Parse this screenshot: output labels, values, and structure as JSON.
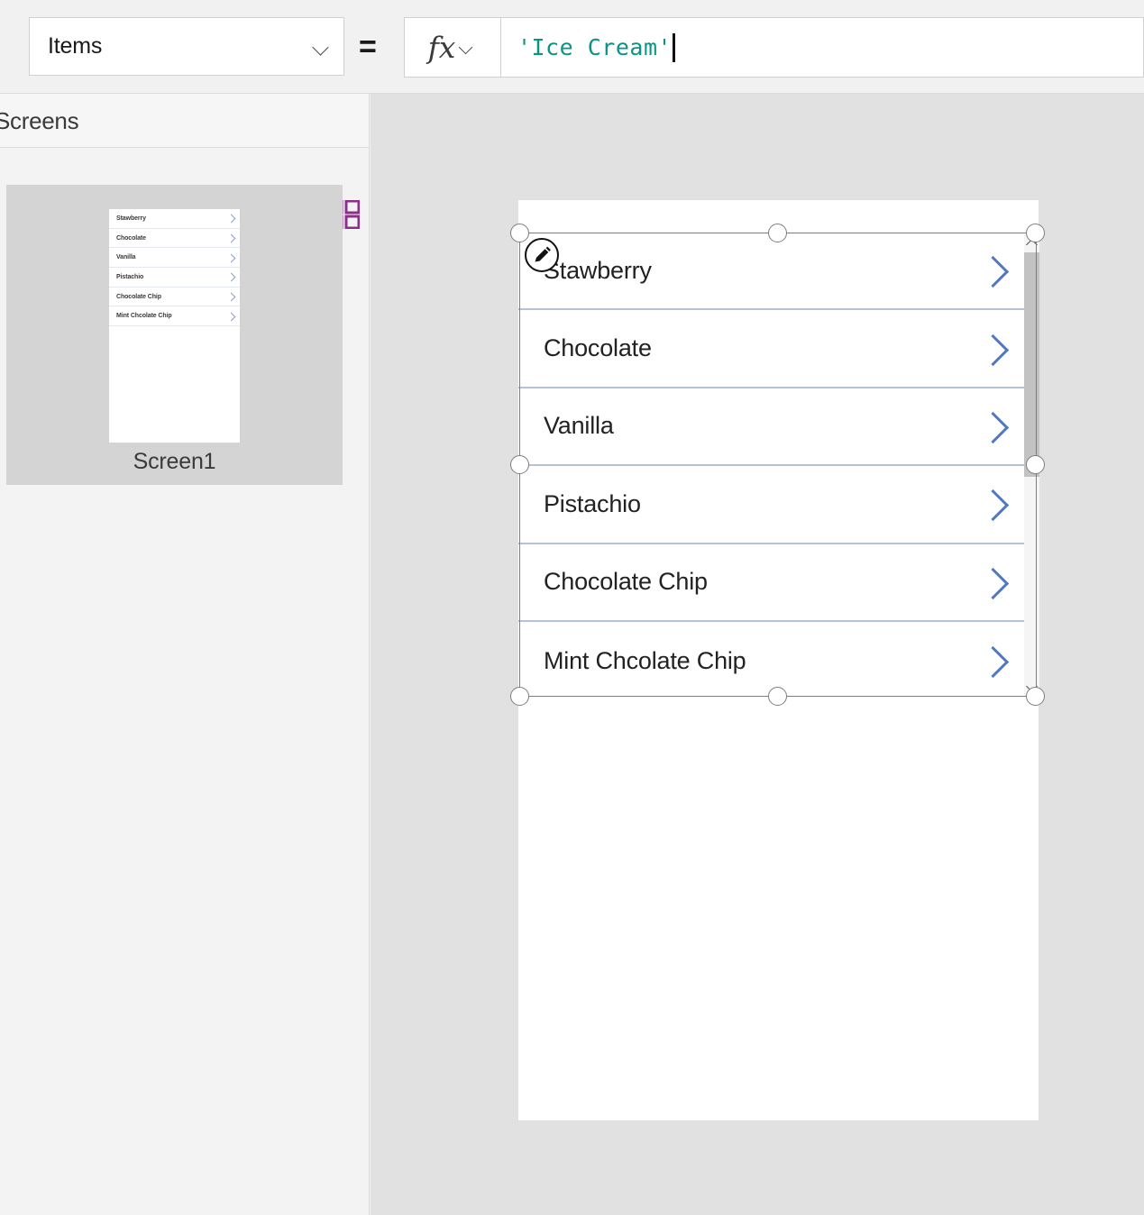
{
  "formula_bar": {
    "property_selector": {
      "value": "Items",
      "icon": "chevron-down-icon"
    },
    "equals": "=",
    "fx": {
      "glyph": "fx",
      "icon": "chevron-down-icon"
    },
    "formula": {
      "value": "'Ice Cream'",
      "has_caret": true,
      "color": "#0a9484"
    }
  },
  "screens_panel": {
    "title": "Screens",
    "view_toggles": [
      {
        "name": "tree-view-icon",
        "color": "#8a8a8a",
        "active": false
      },
      {
        "name": "grid-view-icon",
        "color": "#8c2f8c",
        "active": true
      }
    ],
    "selected_screen": {
      "label": "Screen1",
      "thumbnail_items": [
        "Stawberry",
        "Chocolate",
        "Vanilla",
        "Pistachio",
        "Chocolate Chip",
        "Mint Chcolate Chip"
      ]
    }
  },
  "canvas": {
    "background": "#e1e1e1",
    "screen_background": "#ffffff",
    "gallery": {
      "selected": true,
      "edit_badge_icon": "pencil-icon",
      "divider_color": "#b4c2dc",
      "chevron_color": "#5278bd",
      "items": [
        {
          "label": "Stawberry",
          "chevron": "chevron-right-icon"
        },
        {
          "label": "Chocolate",
          "chevron": "chevron-right-icon"
        },
        {
          "label": "Vanilla",
          "chevron": "chevron-right-icon"
        },
        {
          "label": "Pistachio",
          "chevron": "chevron-right-icon"
        },
        {
          "label": "Chocolate Chip",
          "chevron": "chevron-right-icon"
        },
        {
          "label": "Mint Chcolate Chip",
          "chevron": "chevron-right-icon"
        }
      ],
      "scrollbar": {
        "up_icon": "chevron-up-icon",
        "down_icon": "chevron-down-icon",
        "thumb_color": "#c2c2c2"
      }
    }
  }
}
